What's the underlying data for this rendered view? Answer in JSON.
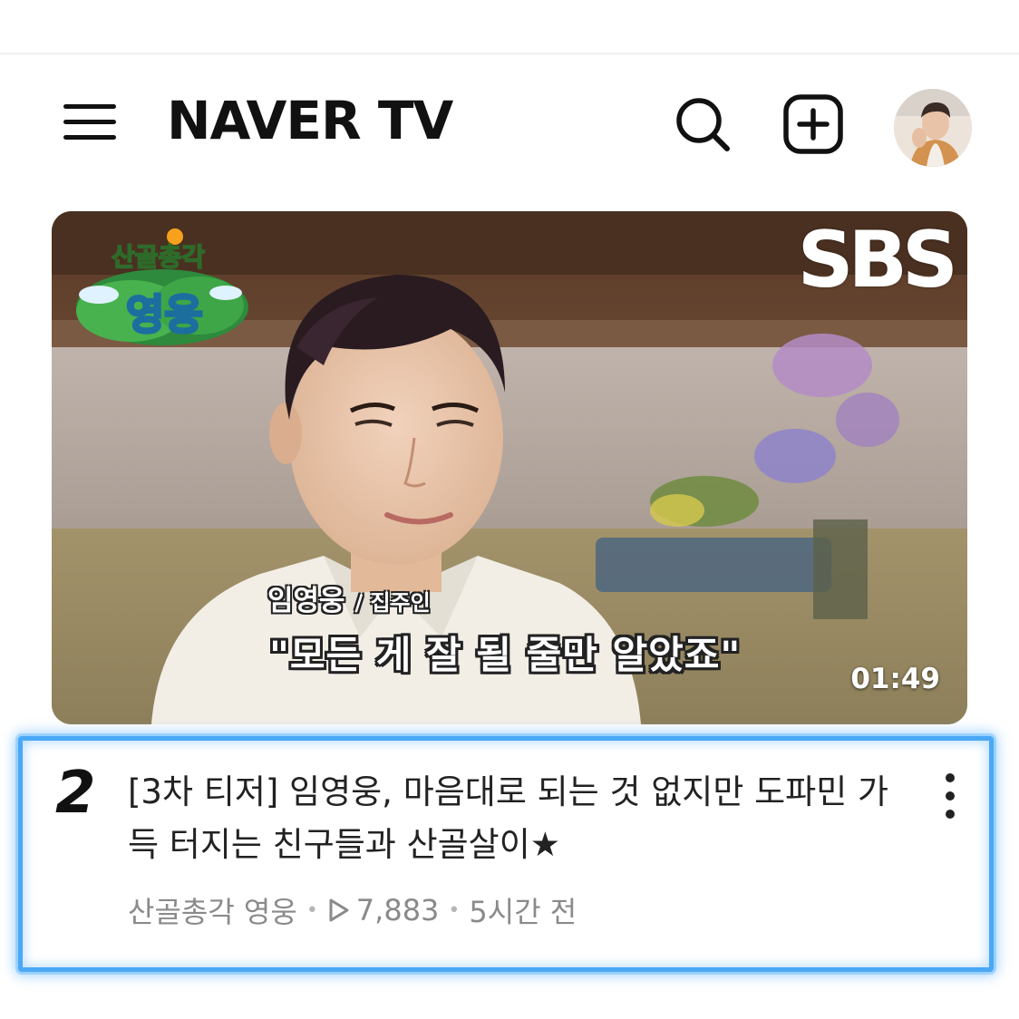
{
  "header": {
    "logo": "NAVER TV",
    "menu_icon": "hamburger-menu-icon",
    "search_icon": "search-icon",
    "upload_icon": "plus-square-icon",
    "avatar_icon": "user-avatar"
  },
  "video": {
    "channel_logo_line1": "산골총각",
    "channel_logo_line2": "영웅",
    "broadcaster": "SBS",
    "subtitle_name": "임영웅",
    "subtitle_role": "/ 집주인",
    "subtitle_quote": "\"모든 게 잘 될 줄만 알았죠\"",
    "duration": "01:49"
  },
  "item": {
    "rank": "2",
    "title": "[3차 티저] 임영웅, 마음대로 되는 것 없지만 도파민 가득 터지는 친구들과 산골살이★",
    "channel": "산골총각 영웅",
    "views": "7,883",
    "time_ago": "5시간 전",
    "separator": "•"
  },
  "colors": {
    "highlight_border": "#4aa8f5",
    "meta_text": "#8a8a8a",
    "logo_text": "#111111"
  }
}
